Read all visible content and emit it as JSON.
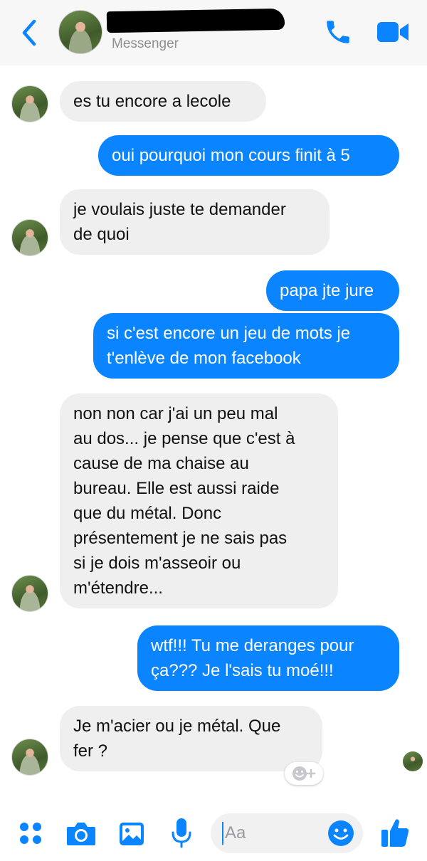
{
  "header": {
    "subtitle": "Messenger"
  },
  "messages": [
    {
      "dir": "in",
      "text": "es tu encore a lecole"
    },
    {
      "dir": "out",
      "text": "oui pourquoi mon cours finit à 5"
    },
    {
      "dir": "in",
      "text": "je voulais juste te demander\nde quoi"
    },
    {
      "dir": "out",
      "text": "papa jte jure"
    },
    {
      "dir": "out",
      "text": "si c'est encore un jeu de mots je\nt'enlève de mon facebook"
    },
    {
      "dir": "in",
      "text": "non non car j'ai un peu mal\nau dos... je pense que c'est à\ncause de ma chaise au\nbureau. Elle est aussi raide\nque du métal. Donc\nprésentement je ne sais pas\nsi je dois m'asseoir ou\nm'étendre..."
    },
    {
      "dir": "out",
      "text": "wtf!!! Tu me deranges pour\nça??? Je l'sais tu moé!!!"
    },
    {
      "dir": "in",
      "text": "Je m'acier ou je métal. Que\nfer ?"
    }
  ],
  "composer": {
    "placeholder": "Aa"
  },
  "colors": {
    "accent": "#0b84ff",
    "incoming_bubble": "#efefef",
    "header_bg": "#f7f7f7"
  },
  "icons": [
    "back-chevron-icon",
    "phone-icon",
    "video-camera-icon",
    "apps-grid-icon",
    "camera-icon",
    "photo-icon",
    "microphone-icon",
    "emoji-icon",
    "thumbs-up-icon",
    "add-reaction-icon"
  ]
}
